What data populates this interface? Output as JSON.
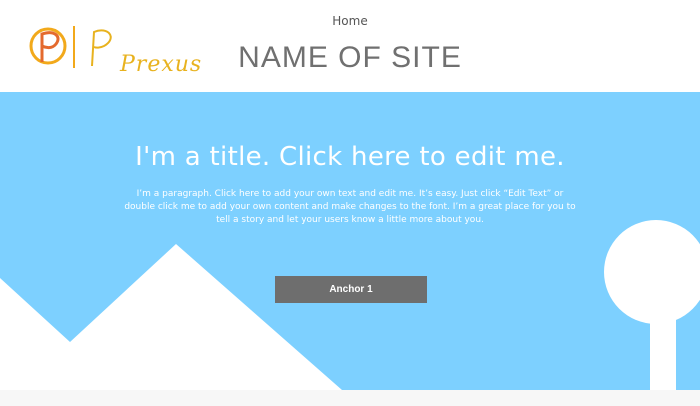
{
  "header": {
    "logo_text": "Prexus",
    "nav_home": "Home",
    "site_name": "NAME OF SITE"
  },
  "hero": {
    "title": "I'm a title. Click here to edit me.",
    "paragraph": "I’m a paragraph. Click here to add your own text and edit me. It’s easy. Just click “Edit Text” or double click me to add your own content and make changes to the font. I’m a great place for you to tell a story and let your users know a little more about you.",
    "button_label": "Anchor 1"
  },
  "colors": {
    "hero_bg": "#7dd0ff",
    "button_bg": "#6e6e6e",
    "logo_accent": "#e8b21e"
  }
}
